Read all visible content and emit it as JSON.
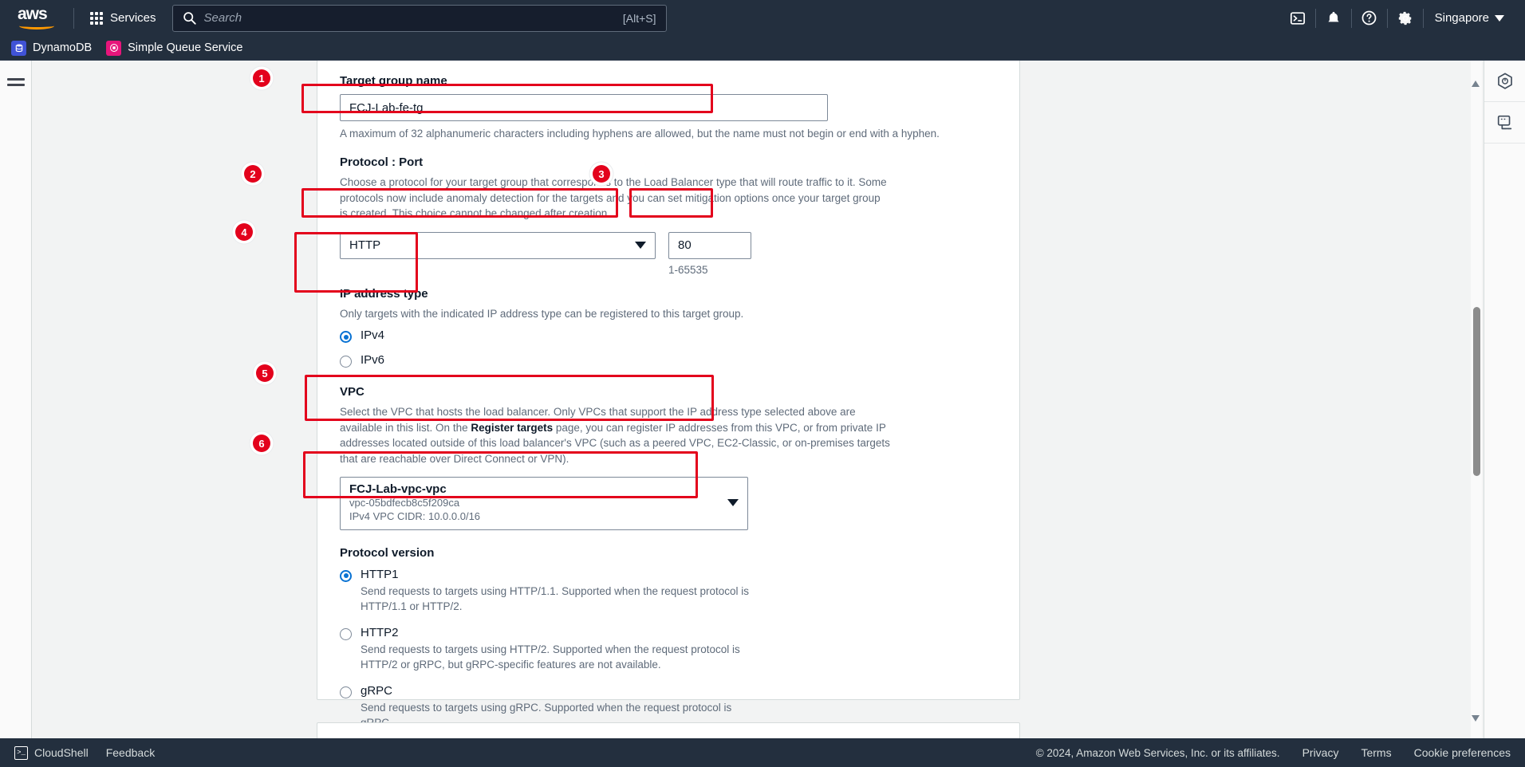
{
  "topnav": {
    "logo_alt": "aws",
    "services_label": "Services",
    "search_placeholder": "Search",
    "search_value": "",
    "search_shortcut": "[Alt+S]",
    "icons": [
      "cloudshell-icon",
      "notifications-bell-icon",
      "help-question-icon",
      "settings-gear-icon"
    ],
    "region_label": "Singapore"
  },
  "subnav": {
    "services": [
      {
        "label": "DynamoDB",
        "badge": "dynamodb-icon",
        "color": "#4053d6"
      },
      {
        "label": "Simple Queue Service",
        "badge": "sqs-icon",
        "color": "#e7157b"
      }
    ]
  },
  "form": {
    "target_group_name": {
      "label": "Target group name",
      "value": "FCJ-Lab-fe-tg",
      "hint": "A maximum of 32 alphanumeric characters including hyphens are allowed, but the name must not begin or end with a hyphen."
    },
    "protocol_port": {
      "label": "Protocol : Port",
      "desc": "Choose a protocol for your target group that corresponds to the Load Balancer type that will route traffic to it. Some protocols now include anomaly detection for the targets and you can set mitigation options once your target group is created. This choice cannot be changed after creation",
      "protocol_value": "HTTP",
      "port_value": "80",
      "port_hint": "1-65535"
    },
    "ip_address_type": {
      "label": "IP address type",
      "desc": "Only targets with the indicated IP address type can be registered to this target group.",
      "options": [
        {
          "label": "IPv4",
          "selected": true
        },
        {
          "label": "IPv6",
          "selected": false
        }
      ]
    },
    "vpc": {
      "label": "VPC",
      "desc_part1": "Select the VPC that hosts the load balancer. Only VPCs that support the IP address type selected above are available in this list. On the ",
      "desc_bold": "Register targets",
      "desc_part2": " page, you can register IP addresses from this VPC, or from private IP addresses located outside of this load balancer's VPC (such as a peered VPC, EC2-Classic, or on-premises targets that are reachable over Direct Connect or VPN).",
      "selected_name": "FCJ-Lab-vpc-vpc",
      "selected_id": "vpc-05bdfecb8c5f209ca",
      "selected_cidr": "IPv4 VPC CIDR: 10.0.0.0/16"
    },
    "protocol_version": {
      "label": "Protocol version",
      "options": [
        {
          "label": "HTTP1",
          "selected": true,
          "desc": "Send requests to targets using HTTP/1.1. Supported when the request protocol is HTTP/1.1 or HTTP/2."
        },
        {
          "label": "HTTP2",
          "selected": false,
          "desc": "Send requests to targets using HTTP/2. Supported when the request protocol is HTTP/2 or gRPC, but gRPC-specific features are not available."
        },
        {
          "label": "gRPC",
          "selected": false,
          "desc": "Send requests to targets using gRPC. Supported when the request protocol is gRPC."
        }
      ]
    }
  },
  "annotations": {
    "accent_color": "#e3021c",
    "badges": [
      "1",
      "2",
      "3",
      "4",
      "5",
      "6"
    ]
  },
  "rightrail": {
    "items": [
      "help-panel-icon",
      "shortcuts-terminal-icon"
    ]
  },
  "footer": {
    "cloudshell_label": "CloudShell",
    "feedback_label": "Feedback",
    "copyright": "© 2024, Amazon Web Services, Inc. or its affiliates.",
    "links": [
      "Privacy",
      "Terms",
      "Cookie preferences"
    ]
  }
}
